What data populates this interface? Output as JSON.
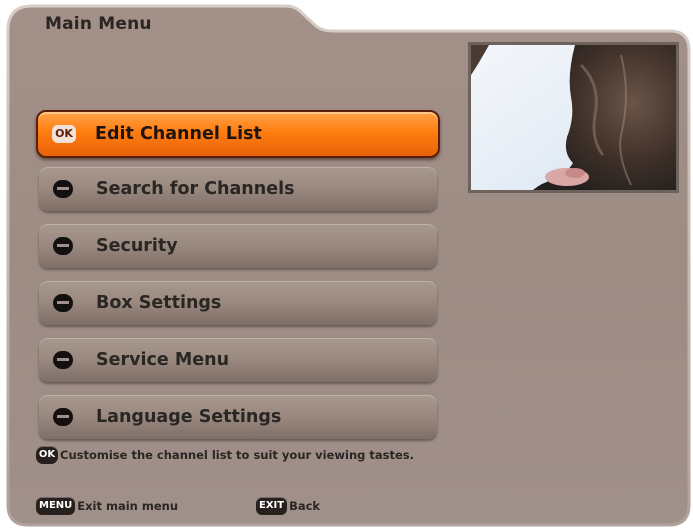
{
  "colors": {
    "panel": "#9c8b83",
    "selected_item": "#ff7e10",
    "item": "#9a8a80",
    "text": "#2a2624"
  },
  "header": {
    "title": "Main Menu"
  },
  "menu": {
    "selected_badge": "OK",
    "items": [
      {
        "label": "Edit Channel List",
        "icon": "ok-badge",
        "selected": true
      },
      {
        "label": "Search for Channels",
        "icon": "arrow-icon",
        "selected": false
      },
      {
        "label": "Security",
        "icon": "arrow-icon",
        "selected": false
      },
      {
        "label": "Box Settings",
        "icon": "arrow-icon",
        "selected": false
      },
      {
        "label": "Service Menu",
        "icon": "arrow-icon",
        "selected": false
      },
      {
        "label": "Language Settings",
        "icon": "arrow-icon",
        "selected": false
      }
    ]
  },
  "preview": {
    "icon": "video-preview"
  },
  "hint": {
    "badge": "OK",
    "text": "Customise the channel list to suit your viewing tastes."
  },
  "footer": {
    "menu_key": "MENU",
    "menu_label": "Exit main menu",
    "exit_key": "EXIT",
    "exit_label": "Back"
  }
}
